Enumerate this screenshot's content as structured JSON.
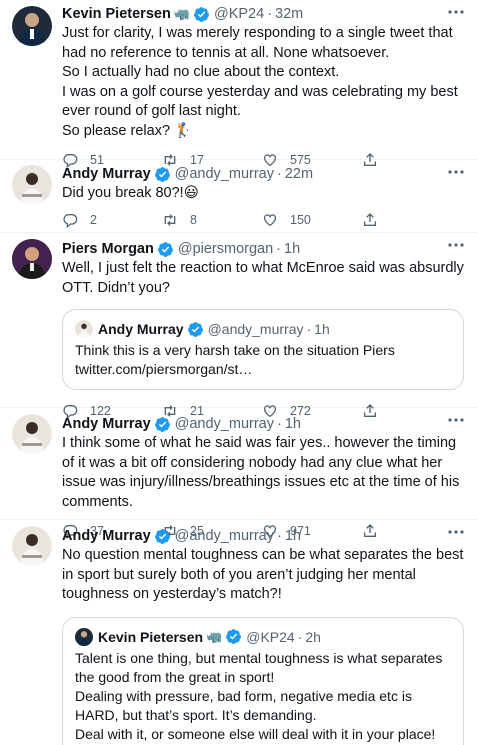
{
  "tweets": [
    {
      "author": "Kevin Pietersen",
      "author_emoji": "🦏",
      "handle": "@KP24",
      "time": "32m",
      "text": "Just for clarity, I was merely responding to a single tweet that had no reference to tennis at all. None whatsoever.\nSo I actually had no clue about the context.\nI was on a golf course yesterday and was celebrating my best ever round of golf last night.\nSo please relax? 🏌",
      "replies": "51",
      "retweets": "17",
      "likes": "575"
    },
    {
      "author": "Andy Murray",
      "handle": "@andy_murray",
      "time": "22m",
      "text": "Did you break 80?!😃",
      "replies": "2",
      "retweets": "8",
      "likes": "150"
    },
    {
      "author": "Piers Morgan",
      "handle": "@piersmorgan",
      "time": "1h",
      "text": "Well, I just felt the reaction to what McEnroe said was absurdly OTT. Didn’t you?",
      "quote": {
        "author": "Andy Murray",
        "handle": "@andy_murray",
        "time": "1h",
        "text": "Think this is a very harsh take on the situation Piers\ntwitter.com/piersmorgan/st…"
      },
      "replies": "122",
      "retweets": "21",
      "likes": "272"
    },
    {
      "author": "Andy Murray",
      "handle": "@andy_murray",
      "time": "1h",
      "text": "I think some of what he said was fair yes.. however the timing of it was a bit off considering nobody had any clue what her issue was injury/illness/breathings issues etc at the time of his comments.",
      "replies": "37",
      "retweets": "25",
      "likes": "971"
    },
    {
      "author": "Andy Murray",
      "handle": "@andy_murray",
      "time": "1h",
      "text": "No question mental toughness can be what separates the best in sport but surely both of you aren’t judging her mental toughness on yesterday’s match?!",
      "quote": {
        "author": "Kevin Pietersen",
        "author_emoji": "🦏",
        "handle": "@KP24",
        "time": "2h",
        "text": "Talent is one thing, but mental toughness is what separates the good from the great in sport!\nDealing with pressure, bad form, negative media etc is HARD, but that’s sport. It’s demanding.\nDeal with it, or someone else will deal with it in your place!\ntwitter.com/piersmorgan/st…"
      }
    }
  ],
  "separator": "·",
  "icons": {
    "verified": "verified-badge-icon",
    "more": "more-icon",
    "reply": "reply-icon",
    "retweet": "retweet-icon",
    "like": "like-icon",
    "share": "share-icon"
  },
  "colors": {
    "verified": "#1d9bf0",
    "text": "#0f1419",
    "muted": "#536471",
    "border": "#eff3f4"
  }
}
